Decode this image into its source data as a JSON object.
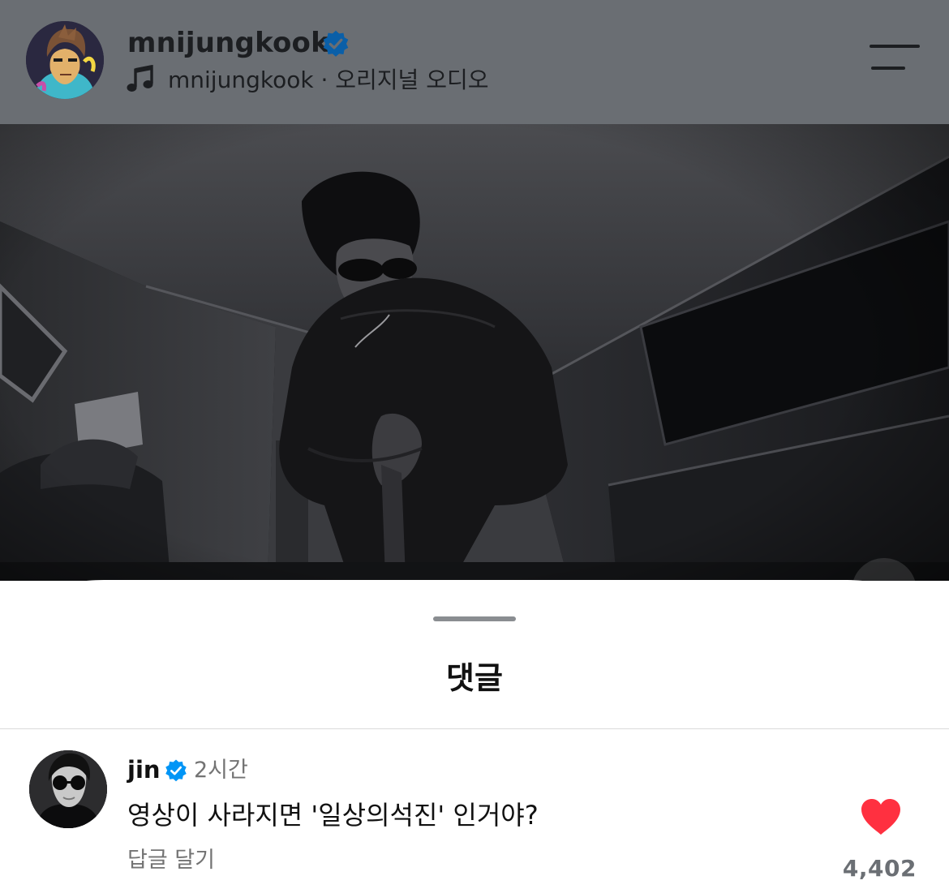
{
  "header": {
    "username": "mnijungkook",
    "audio_owner": "mnijungkook",
    "audio_separator": " · ",
    "audio_title": "오리지널 오디오",
    "verified": true
  },
  "sheet": {
    "title": "댓글"
  },
  "comment": {
    "username": "jin",
    "verified": true,
    "time": "2시간",
    "text": "영상이 사라지면 '일상의석진' 인거야?",
    "reply_label": "답글 달기",
    "likes": "4,402",
    "liked": true
  },
  "colors": {
    "header_bg": "#6a6e73",
    "verified_blue": "#0095f6",
    "heart_red": "#ff3040",
    "sheet_bg": "#ffffff",
    "muted_text": "#737373"
  },
  "icons": {
    "verified": "verified-badge-icon",
    "music": "music-note-icon",
    "menu": "menu-icon",
    "heart": "heart-filled-icon"
  }
}
